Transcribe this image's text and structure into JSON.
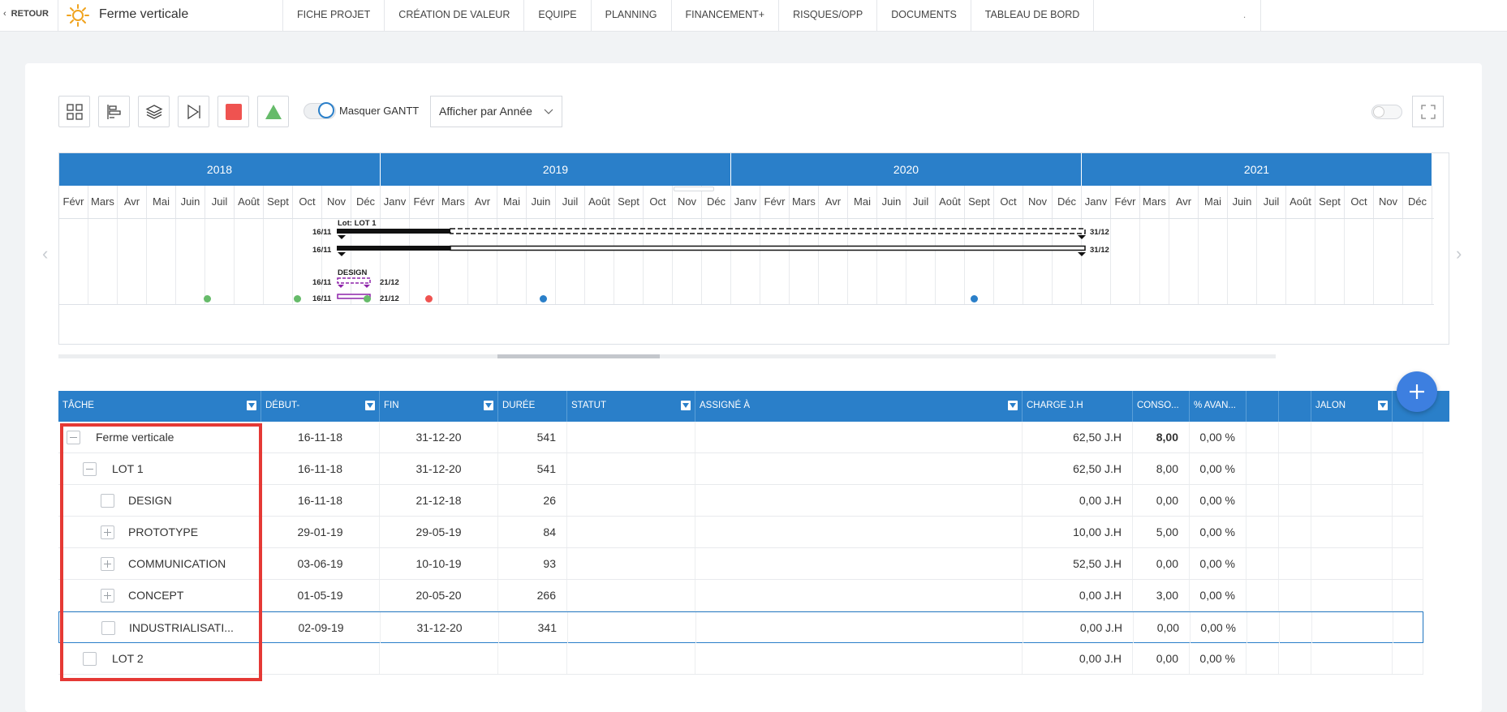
{
  "nav": {
    "back_label": "RETOUR",
    "project_title": "Ferme verticale",
    "tabs": [
      "FICHE PROJET",
      "CRÉATION DE VALEUR",
      "EQUIPE",
      "PLANNING",
      "FINANCEMENT+",
      "RISQUES/OPP",
      "DOCUMENTS",
      "TABLEAU DE BORD"
    ],
    "blank_tab": "."
  },
  "toolbar": {
    "masquer_gantt_label": "Masquer GANTT",
    "view_select_value": "Afficher par Année",
    "stop_color": "#ef5350",
    "triangle_color": "#66bb6a"
  },
  "gantt": {
    "years": [
      "2018",
      "2019",
      "2020",
      "2021"
    ],
    "months": [
      "Févr",
      "Mars",
      "Avr",
      "Mai",
      "Juin",
      "Juil",
      "Août",
      "Sept",
      "Oct",
      "Nov",
      "Déc",
      "Janv",
      "Févr",
      "Mars",
      "Avr",
      "Mai",
      "Juin",
      "Juil",
      "Août",
      "Sept",
      "Oct",
      "Nov",
      "Déc",
      "Janv",
      "Févr",
      "Mars",
      "Avr",
      "Mai",
      "Juin",
      "Juil",
      "Août",
      "Sept",
      "Oct",
      "Nov",
      "Déc",
      "Janv",
      "Févr",
      "Mars",
      "Avr",
      "Mai",
      "Juin",
      "Juil",
      "Août",
      "Sept",
      "Oct",
      "Nov",
      "Déc"
    ],
    "lot_label": "Lot: LOT 1",
    "design_label": "DESIGN",
    "start_label": "16/11",
    "end_label_lot": "31/12",
    "end_label_design": "21/12",
    "milestone_colors": [
      "#66bb6a",
      "#66bb6a",
      "#66bb6a",
      "#ef5350",
      "#2a7fc9",
      "#2a7fc9"
    ]
  },
  "table": {
    "columns": [
      "TÂCHE",
      "DÉBUT-",
      "FIN",
      "DURÉE",
      "STATUT",
      "ASSIGNÉ À",
      "CHARGE J.H",
      "CONSO...",
      "% AVAN...",
      "",
      "",
      "JALON",
      ""
    ],
    "rows": [
      {
        "name": "Ferme verticale",
        "start": "16-11-18",
        "end": "31-12-20",
        "duration": "541",
        "charge": "62,50 J.H",
        "conso": "8,00",
        "avancement": "0,00 %"
      },
      {
        "name": "LOT 1",
        "start": "16-11-18",
        "end": "31-12-20",
        "duration": "541",
        "charge": "62,50 J.H",
        "conso": "8,00",
        "avancement": "0,00 %"
      },
      {
        "name": "DESIGN",
        "start": "16-11-18",
        "end": "21-12-18",
        "duration": "26",
        "charge": "0,00 J.H",
        "conso": "0,00",
        "avancement": "0,00 %"
      },
      {
        "name": "PROTOTYPE",
        "start": "29-01-19",
        "end": "29-05-19",
        "duration": "84",
        "charge": "10,00 J.H",
        "conso": "5,00",
        "avancement": "0,00 %"
      },
      {
        "name": "COMMUNICATION",
        "start": "03-06-19",
        "end": "10-10-19",
        "duration": "93",
        "charge": "52,50 J.H",
        "conso": "0,00",
        "avancement": "0,00 %"
      },
      {
        "name": "CONCEPT",
        "start": "01-05-19",
        "end": "20-05-20",
        "duration": "266",
        "charge": "0,00 J.H",
        "conso": "3,00",
        "avancement": "0,00 %"
      },
      {
        "name": "INDUSTRIALISATI...",
        "start": "02-09-19",
        "end": "31-12-20",
        "duration": "341",
        "charge": "0,00 J.H",
        "conso": "0,00",
        "avancement": "0,00 %"
      },
      {
        "name": "LOT 2",
        "start": "",
        "end": "",
        "duration": "",
        "charge": "0,00 J.H",
        "conso": "0,00",
        "avancement": "0,00 %"
      }
    ]
  }
}
